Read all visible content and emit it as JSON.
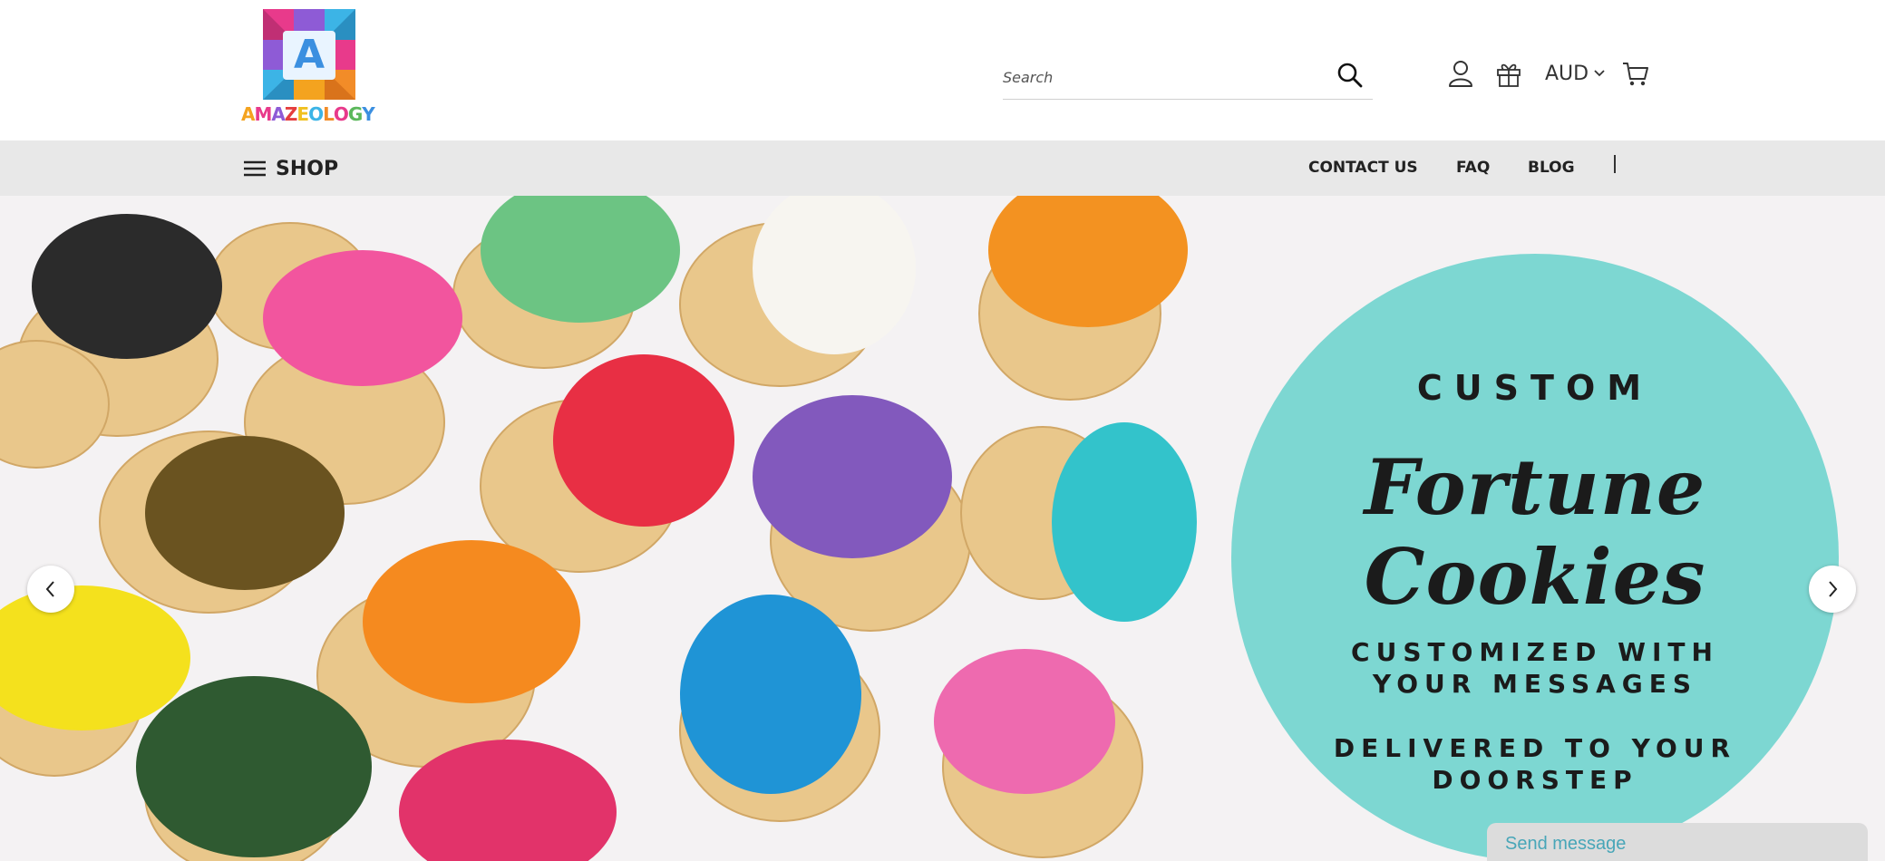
{
  "header": {
    "logo": {
      "letter": "A",
      "wordmark": [
        {
          "text": "A",
          "color": "#f4a31f"
        },
        {
          "text": "M",
          "color": "#e83a8b"
        },
        {
          "text": "A",
          "color": "#8e5bd6"
        },
        {
          "text": "Z",
          "color": "#e53e3e"
        },
        {
          "text": "E",
          "color": "#f0c020"
        },
        {
          "text": "O",
          "color": "#3cb4e6"
        },
        {
          "text": "L",
          "color": "#f28c28"
        },
        {
          "text": "O",
          "color": "#e83a8b"
        },
        {
          "text": "G",
          "color": "#5bb85b"
        },
        {
          "text": "Y",
          "color": "#3b8fe0"
        }
      ]
    },
    "search": {
      "placeholder": "Search",
      "value": ""
    },
    "icons": [
      "user-icon",
      "gift-icon",
      "cart-icon",
      "search-icon"
    ],
    "currency": "AUD"
  },
  "nav": {
    "shop_label": "SHOP",
    "links": [
      {
        "label": "CONTACT US"
      },
      {
        "label": "FAQ"
      },
      {
        "label": "BLOG"
      }
    ]
  },
  "hero": {
    "circle_color": "#7dd7d2",
    "line1": "CUSTOM",
    "line2": "Fortune Cookies",
    "line3a": "CUSTOMIZED WITH",
    "line3b": "YOUR MESSAGES",
    "line4a": "DELIVERED TO YOUR",
    "line4b": "DOORSTEP",
    "prev_icon": "chevron-left-icon",
    "next_icon": "chevron-right-icon"
  },
  "chat": {
    "label": "Send message"
  }
}
